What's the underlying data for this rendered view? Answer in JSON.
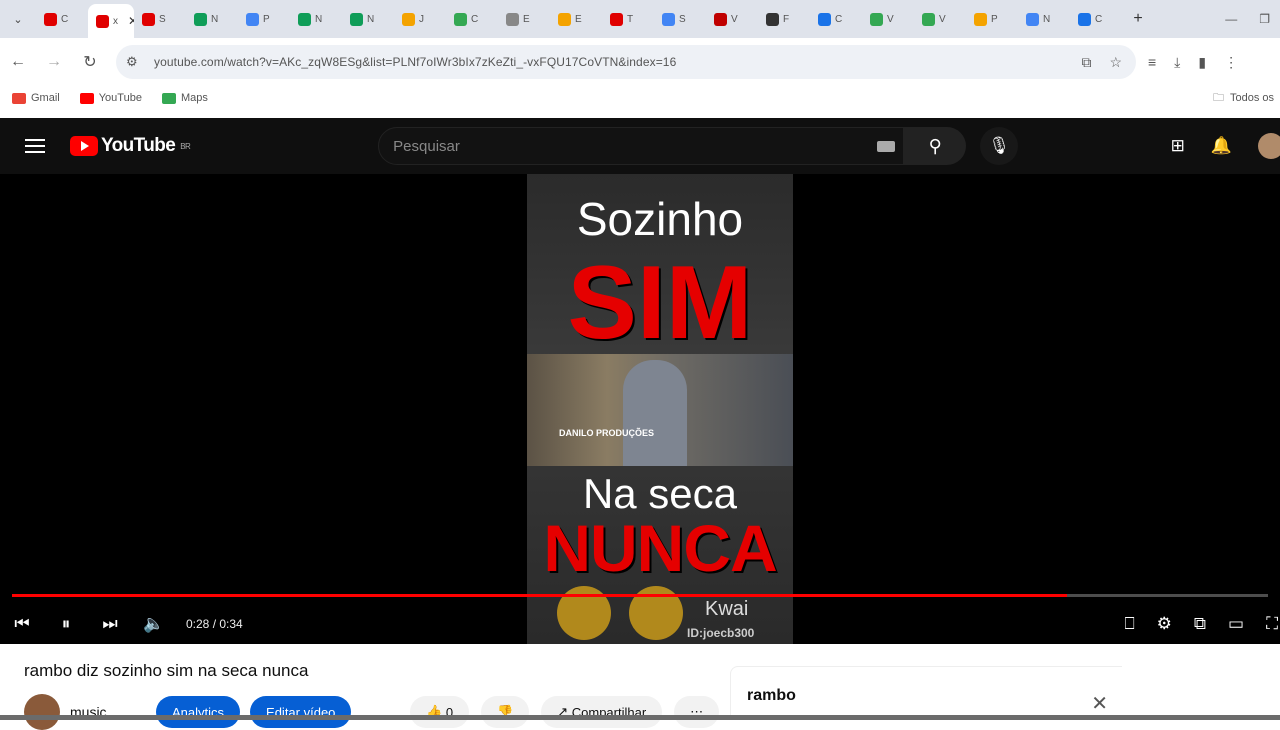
{
  "browser": {
    "tabs": [
      {
        "letter": "C",
        "color": "#e00000"
      },
      {
        "letter": "x",
        "color": "#e00000",
        "active": true
      },
      {
        "letter": "S",
        "color": "#e00000"
      },
      {
        "letter": "N",
        "color": "#0f9d58"
      },
      {
        "letter": "P",
        "color": "#4285f4"
      },
      {
        "letter": "N",
        "color": "#0f9d58"
      },
      {
        "letter": "N",
        "color": "#0f9d58"
      },
      {
        "letter": "J",
        "color": "#f4a300"
      },
      {
        "letter": "C",
        "color": "#34a853"
      },
      {
        "letter": "E",
        "color": "#888888"
      },
      {
        "letter": "E",
        "color": "#f4a300"
      },
      {
        "letter": "T",
        "color": "#e00000"
      },
      {
        "letter": "S",
        "color": "#4285f4"
      },
      {
        "letter": "V",
        "color": "#c00000"
      },
      {
        "letter": "F",
        "color": "#333333"
      },
      {
        "letter": "C",
        "color": "#1a73e8"
      },
      {
        "letter": "V",
        "color": "#34a853"
      },
      {
        "letter": "V",
        "color": "#34a853"
      },
      {
        "letter": "P",
        "color": "#f4a300"
      },
      {
        "letter": "N",
        "color": "#4285f4"
      },
      {
        "letter": "C",
        "color": "#1a73e8"
      }
    ],
    "active_tab_close": "✕",
    "new_tab": "+",
    "url": "youtube.com/watch?v=AKc_zqW8ESg&list=PLNf7oIWr3bIx7zKeZti_-vxFQU17CoVTN&index=16",
    "bookmarks": [
      {
        "label": "Gmail",
        "color": "#ea4335"
      },
      {
        "label": "YouTube",
        "color": "#ff0000"
      },
      {
        "label": "Maps",
        "color": "#34a853"
      }
    ],
    "bookmarks_right": "Todos os"
  },
  "youtube": {
    "logo_text": "YouTube",
    "logo_region": "BR",
    "search_placeholder": "Pesquisar",
    "video": {
      "line1": "Sozinho",
      "line2": "SIM",
      "stamp": "DANILO PRODUÇÕES",
      "line3": "Na seca",
      "line4": "NUNCA",
      "watermark": "Kwai",
      "watermark_id": "ID:joecb300"
    },
    "player": {
      "time": "0:28 / 0:34",
      "progress": 0.84
    },
    "title": "rambo diz sozinho sim na seca nunca",
    "channel_name": "music ...",
    "analytics_label": "Analytics",
    "edit_label": "Editar vídeo",
    "likes": "0",
    "share_label": "Compartilhar",
    "query_chip": "rambo"
  }
}
